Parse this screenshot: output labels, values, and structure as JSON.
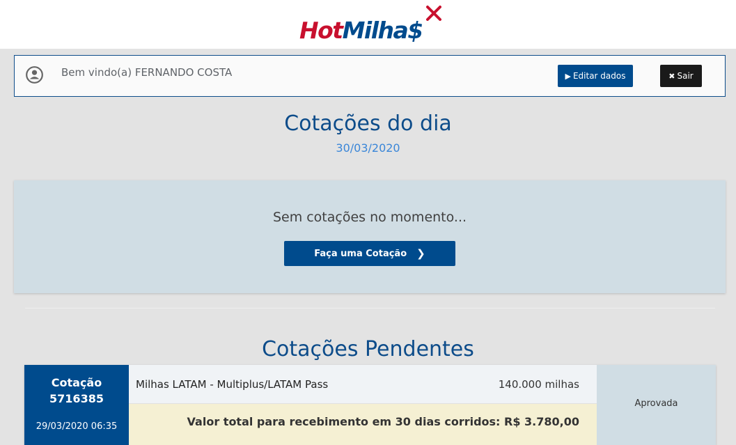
{
  "header": {
    "logo_hot": "Hot",
    "logo_milhas": "Milha$"
  },
  "welcome": {
    "text": "Bem vindo(a) FERNANDO COSTA",
    "edit_label": "Editar dados",
    "exit_label": "Sair"
  },
  "daily": {
    "title": "Cotações do dia",
    "date": "30/03/2020",
    "empty_message": "Sem cotações no momento...",
    "quote_button": "Faça uma Cotação"
  },
  "pending": {
    "title": "Cotações Pendentes",
    "items": [
      {
        "label": "Cotação",
        "id": "5716385",
        "datetime": "29/03/2020 06:35",
        "program": "Milhas LATAM - Multiplus/LATAM Pass",
        "miles": "140.000 milhas",
        "total": "Valor total para recebimento em 30 dias corridos: R$ 3.780,00",
        "status": "Aprovada"
      }
    ]
  },
  "colors": {
    "brand_blue": "#004b8d",
    "brand_red": "#c8102e",
    "panel": "#d0dde4",
    "highlight": "#f5f0d3"
  }
}
